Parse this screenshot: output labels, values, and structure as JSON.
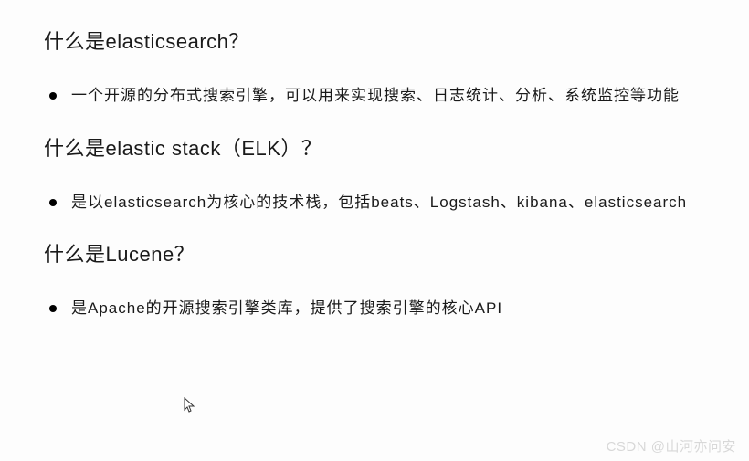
{
  "sections": [
    {
      "heading": "什么是elasticsearch？",
      "bullets": [
        "一个开源的分布式搜索引擎，可以用来实现搜索、日志统计、分析、系统监控等功能"
      ]
    },
    {
      "heading": "什么是elastic stack（ELK）？",
      "bullets": [
        "是以elasticsearch为核心的技术栈，包括beats、Logstash、kibana、elasticsearch"
      ]
    },
    {
      "heading": "什么是Lucene？",
      "bullets": [
        "是Apache的开源搜索引擎类库，提供了搜索引擎的核心API"
      ]
    }
  ],
  "watermark": "CSDN @山河亦问安"
}
